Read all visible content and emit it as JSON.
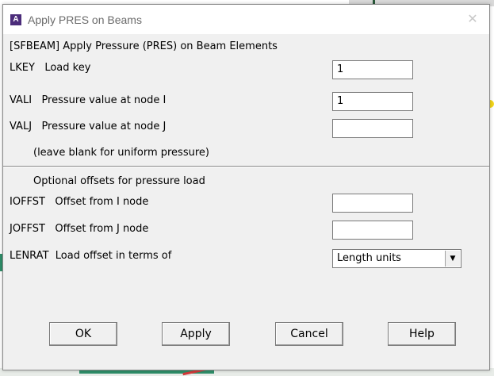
{
  "window": {
    "title": "Apply PRES on Beams",
    "app_icon_letter": "A",
    "close_glyph": "✕"
  },
  "dialog": {
    "command": "[SFBEAM]  Apply Pressure (PRES) on Beam Elements",
    "fields": [
      {
        "key": "LKEY",
        "label": "Load key",
        "value": "1"
      },
      {
        "key": "VALI",
        "label": "Pressure value at node I",
        "value": "1"
      },
      {
        "key": "VALJ",
        "label": "Pressure value at node J",
        "value": ""
      }
    ],
    "note": "(leave blank for uniform pressure)",
    "optional_heading": "Optional offsets for pressure load",
    "offsets": [
      {
        "key": "IOFFST",
        "label": "Offset from I node",
        "value": ""
      },
      {
        "key": "JOFFST",
        "label": "Offset from J node",
        "value": ""
      }
    ],
    "lenrat": {
      "key": "LENRAT",
      "label": "Load offset in terms of",
      "selected": "Length units"
    }
  },
  "buttons": {
    "ok": "OK",
    "apply": "Apply",
    "cancel": "Cancel",
    "help": "Help"
  },
  "icons": {
    "dropdown_arrow": "▼"
  }
}
